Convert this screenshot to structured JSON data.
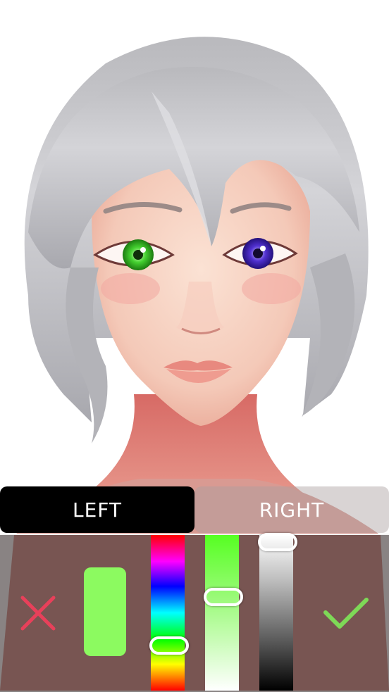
{
  "tabs": {
    "left_label": "LEFT",
    "right_label": "RIGHT",
    "active": "left"
  },
  "picker": {
    "selected_color": "#8cfa60",
    "hue_fraction": 0.67,
    "saturation_fraction": 0.4,
    "value_fraction": 0.0
  },
  "icons": {
    "cancel": "close-icon",
    "confirm": "checkmark-icon"
  },
  "colors": {
    "cancel": "#e8405a",
    "confirm": "#7ed957",
    "left_eye": "#44d030",
    "right_eye": "#5030d0",
    "hair": "#c8c8cc"
  }
}
